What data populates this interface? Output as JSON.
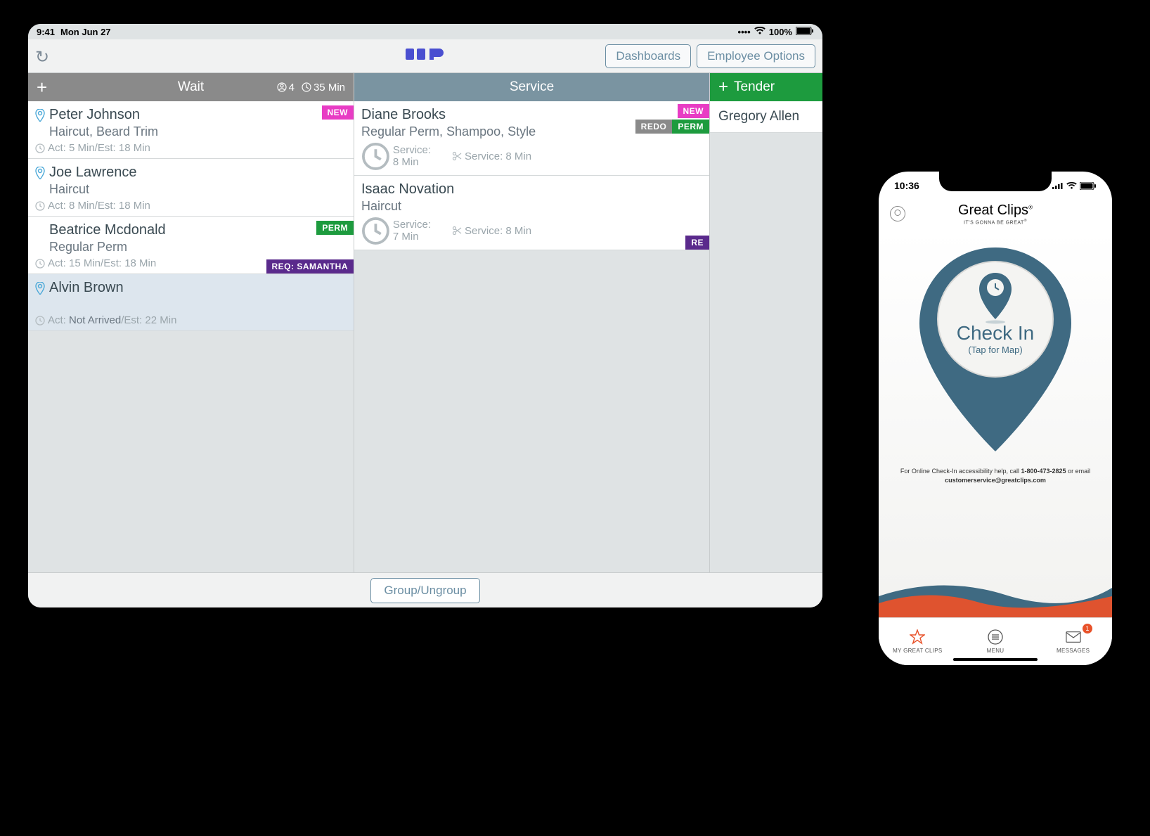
{
  "ipad": {
    "status": {
      "time": "9:41",
      "date": "Mon Jun 27",
      "battery": "100%"
    },
    "toolbar": {
      "dashboards": "Dashboards",
      "employee_options": "Employee Options",
      "logo": "ICS"
    },
    "columns": {
      "wait": {
        "title": "Wait",
        "count": "4",
        "est": "35 Min",
        "items": [
          {
            "name": "Peter Johnson",
            "services": "Haircut, Beard Trim",
            "time": "Act: 5 Min/Est: 18 Min",
            "badges_top": [
              {
                "label": "NEW",
                "cls": "new"
              }
            ],
            "has_pin": true
          },
          {
            "name": "Joe Lawrence",
            "services": "Haircut",
            "time": "Act: 8 Min/Est: 18 Min",
            "has_pin": true
          },
          {
            "name": "Beatrice Mcdonald",
            "services": "Regular Perm",
            "time": "Act: 15 Min/Est: 18 Min",
            "badges_top": [
              {
                "label": "PERM",
                "cls": "perm"
              }
            ],
            "badges_bottom": [
              {
                "label": "REQ: SAMANTHA",
                "cls": "req"
              }
            ]
          },
          {
            "name": "Alvin Brown",
            "services": "",
            "time_prefix": "Act: ",
            "time_strong": "Not Arrived",
            "time_suffix": "/Est: 22 Min",
            "has_pin": true,
            "selected": true
          }
        ]
      },
      "service": {
        "title": "Service",
        "items": [
          {
            "name": "Diane Brooks",
            "services": "Regular Perm, Shampoo, Style",
            "svc1": "Service: 8 Min",
            "svc2": "Service: 8 Min",
            "badges_top": [
              {
                "label": "NEW",
                "cls": "new"
              }
            ],
            "badges_mid": [
              {
                "label": "REDO",
                "cls": "redo"
              },
              {
                "label": "PERM",
                "cls": "perm"
              }
            ]
          },
          {
            "name": "Isaac Novation",
            "services": "Haircut",
            "svc1": "Service: 7 Min",
            "svc2": "Service: 8 Min",
            "badges_bottom": [
              {
                "label": "RE",
                "cls": "req"
              }
            ]
          }
        ]
      },
      "tender": {
        "title": "Tender",
        "items": [
          "Gregory Allen"
        ]
      }
    },
    "bottom": {
      "group": "Group/Ungroup"
    }
  },
  "iphone": {
    "status": {
      "time": "10:36"
    },
    "brand": {
      "name": "Great Clips",
      "tagline": "IT'S GONNA BE GREAT"
    },
    "checkin": {
      "title": "Check In",
      "subtitle": "(Tap for Map)"
    },
    "help": {
      "prefix": "For Online Check-In accessibility help, call ",
      "phone": "1-800-473-2825",
      "mid": " or email ",
      "email": "customerservice@greatclips.com"
    },
    "tabs": {
      "t1": "MY GREAT CLIPS",
      "t2": "MENU",
      "t3": "MESSAGES",
      "badge": "1"
    }
  }
}
